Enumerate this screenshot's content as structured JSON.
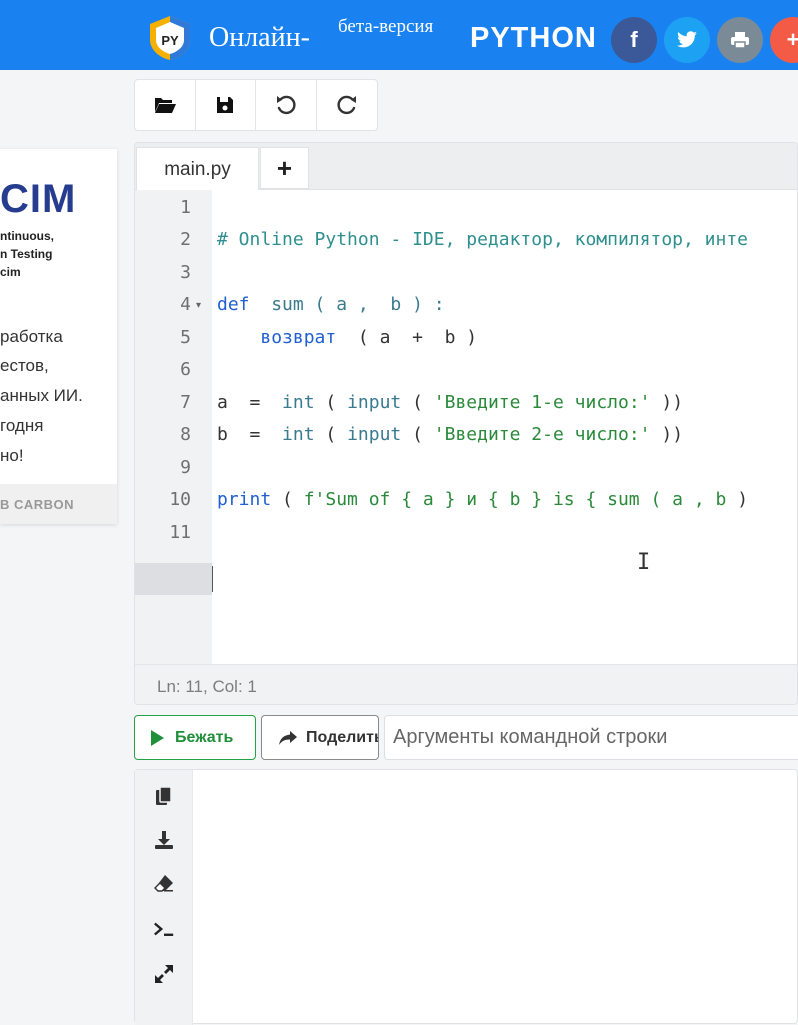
{
  "header": {
    "logo_text": "PY",
    "brand": "Онлайн-",
    "beta": "бета-версия",
    "python": "PYTHON",
    "social": {
      "facebook": "f",
      "plus": "+"
    }
  },
  "ad": {
    "brand": "CIM",
    "tag_lines": [
      "ntinuous,",
      "n Testing",
      "cim"
    ],
    "text_lines": [
      "работка",
      "естов,",
      "анных ИИ.",
      "годня",
      "но!"
    ],
    "footer": "B CARBON"
  },
  "toolbar": {
    "icons": [
      "folder-open-icon",
      "save-icon",
      "undo-icon",
      "redo-icon"
    ]
  },
  "editor": {
    "tabs": [
      {
        "label": "main.py"
      }
    ],
    "add_tab_label": "+",
    "line_numbers": [
      "1",
      "2",
      "3",
      "4",
      "5",
      "6",
      "7",
      "8",
      "9",
      "10",
      "11"
    ],
    "code": {
      "l2_comment": "# Online Python - IDE, редактор, компилятор, инте",
      "l4_kw": "def",
      "l4_rest": "  sum ( a ,  b ) :",
      "l5_kw": "возврат",
      "l5_rest": "  ( a  +  b )",
      "l7_a": "a  =  ",
      "l7_int": "int",
      "l7_mid": " ( ",
      "l7_input": "input",
      "l7_mid2": " ( ",
      "l7_str": "'Введите 1-е число:'",
      "l7_end": " ))",
      "l8_a": "b  =  ",
      "l8_int": "int",
      "l8_mid": " ( ",
      "l8_input": "input",
      "l8_mid2": " ( ",
      "l8_str": "'Введите 2-е число:'",
      "l8_end": " ))",
      "l10_print": "print",
      "l10_rest1": " ( ",
      "l10_f": "f'Sum of { a } и { b } is { sum ( a , b ",
      "l10_rest2": ")"
    },
    "status": "Ln: 11, Col: 1",
    "active_line": "11"
  },
  "run": {
    "run_label": "Бежать",
    "share_label": "Поделиться",
    "args_placeholder": "Аргументы командной строки"
  },
  "output": {
    "icons": [
      "copy-icon",
      "download-icon",
      "eraser-icon",
      "terminal-icon",
      "expand-icon"
    ]
  },
  "colors": {
    "header_blue": "#1a82f0",
    "run_green": "#25a244",
    "keyword_blue": "#1f5fd0",
    "string_green": "#2a8a3a"
  }
}
